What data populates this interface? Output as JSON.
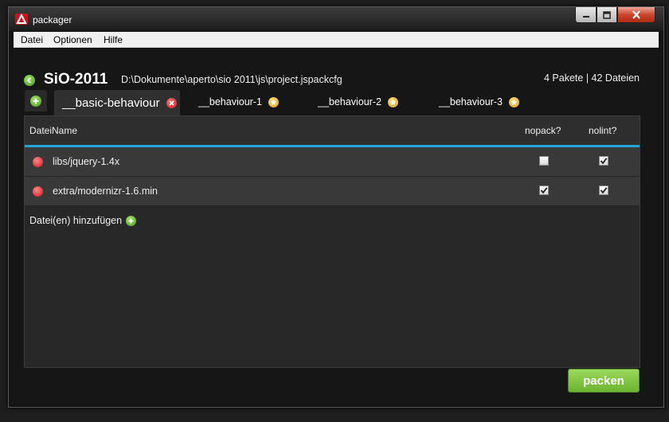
{
  "window": {
    "title": "packager"
  },
  "menu": {
    "items": [
      "Datei",
      "Optionen",
      "Hilfe"
    ]
  },
  "project": {
    "name": "SiO-2011",
    "path": "D:\\Dokumente\\aperto\\sio 2011\\js\\project.jspackcfg",
    "stats": "4 Pakete | 42 Dateien"
  },
  "tabs": [
    {
      "label": "__basic-behaviour",
      "active": true,
      "badge": "close-icon"
    },
    {
      "label": "__behaviour-1",
      "active": false,
      "badge": "star-icon"
    },
    {
      "label": "__behaviour-2",
      "active": false,
      "badge": "star-icon"
    },
    {
      "label": "__behaviour-3",
      "active": false,
      "badge": "star-icon"
    }
  ],
  "table": {
    "columns": [
      "DateiName",
      "nopack?",
      "nolint?"
    ],
    "rows": [
      {
        "name": "libs/jquery-1.4x",
        "nopack": false,
        "nolint": true
      },
      {
        "name": "extra/modernizr-1.6.min",
        "nopack": true,
        "nolint": true
      }
    ]
  },
  "add_files_label": "Datei(en) hinzufügen",
  "pack_button_label": "packen",
  "colors": {
    "accent_blue": "#22a6d6",
    "green": "#6cb532",
    "red": "#d4101b",
    "star": "#d99a17"
  }
}
